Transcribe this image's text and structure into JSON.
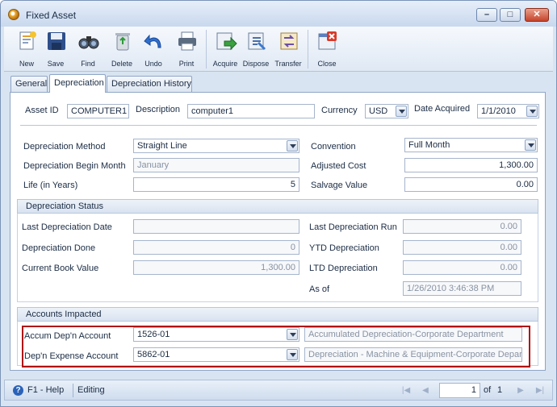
{
  "window": {
    "title": "Fixed Asset"
  },
  "toolbar": {
    "buttons": [
      {
        "label": "New",
        "icon": "new-document-icon"
      },
      {
        "label": "Save",
        "icon": "floppy-disk-icon"
      },
      {
        "label": "Find",
        "icon": "binoculars-icon"
      },
      {
        "label": "Delete",
        "icon": "recycle-bin-icon"
      },
      {
        "label": "Undo",
        "icon": "undo-arrow-icon"
      },
      {
        "label": "Print",
        "icon": "printer-icon"
      },
      {
        "label": "Acquire",
        "icon": "acquire-icon"
      },
      {
        "label": "Dispose",
        "icon": "dispose-icon"
      },
      {
        "label": "Transfer",
        "icon": "transfer-icon"
      },
      {
        "label": "Close",
        "icon": "close-window-icon"
      }
    ]
  },
  "tabs": [
    {
      "label": "General"
    },
    {
      "label": "Depreciation",
      "active": true
    },
    {
      "label": "Depreciation History"
    }
  ],
  "header": {
    "asset_id_label": "Asset ID",
    "asset_id": "COMPUTER1",
    "description_label": "Description",
    "description": "computer1",
    "currency_label": "Currency",
    "currency": "USD",
    "date_acquired_label": "Date Acquired",
    "date_acquired": "1/1/2010"
  },
  "depreciation": {
    "method_label": "Depreciation Method",
    "method": "Straight Line",
    "begin_month_label": "Depreciation Begin Month",
    "begin_month": "January",
    "life_label": "Life (in Years)",
    "life": "5",
    "convention_label": "Convention",
    "convention": "Full Month",
    "adjusted_cost_label": "Adjusted Cost",
    "adjusted_cost": "1,300.00",
    "salvage_label": "Salvage Value",
    "salvage": "0.00"
  },
  "status": {
    "title": "Depreciation Status",
    "last_date_label": "Last Depreciation Date",
    "last_date": "",
    "done_label": "Depreciation Done",
    "done": "0",
    "book_value_label": "Current Book Value",
    "book_value": "1,300.00",
    "last_run_label": "Last Depreciation Run",
    "last_run": "0.00",
    "ytd_label": "YTD Depreciation",
    "ytd": "0.00",
    "ltd_label": "LTD Depreciation",
    "ltd": "0.00",
    "as_of_label": "As of",
    "as_of": "1/26/2010 3:46:38 PM"
  },
  "accounts": {
    "title": "Accounts Impacted",
    "accum_label": "Accum Dep'n Account",
    "accum": "1526-01",
    "accum_desc": "Accumulated Depreciation-Corporate Department",
    "expense_label": "Dep'n Expense Account",
    "expense": "5862-01",
    "expense_desc": "Depreciation - Machine & Equipment-Corporate Departr",
    "highlight_color": "#b01010"
  },
  "statusbar": {
    "help": "F1 - Help",
    "mode": "Editing",
    "page": "1",
    "of_label": "of",
    "total": "1"
  }
}
